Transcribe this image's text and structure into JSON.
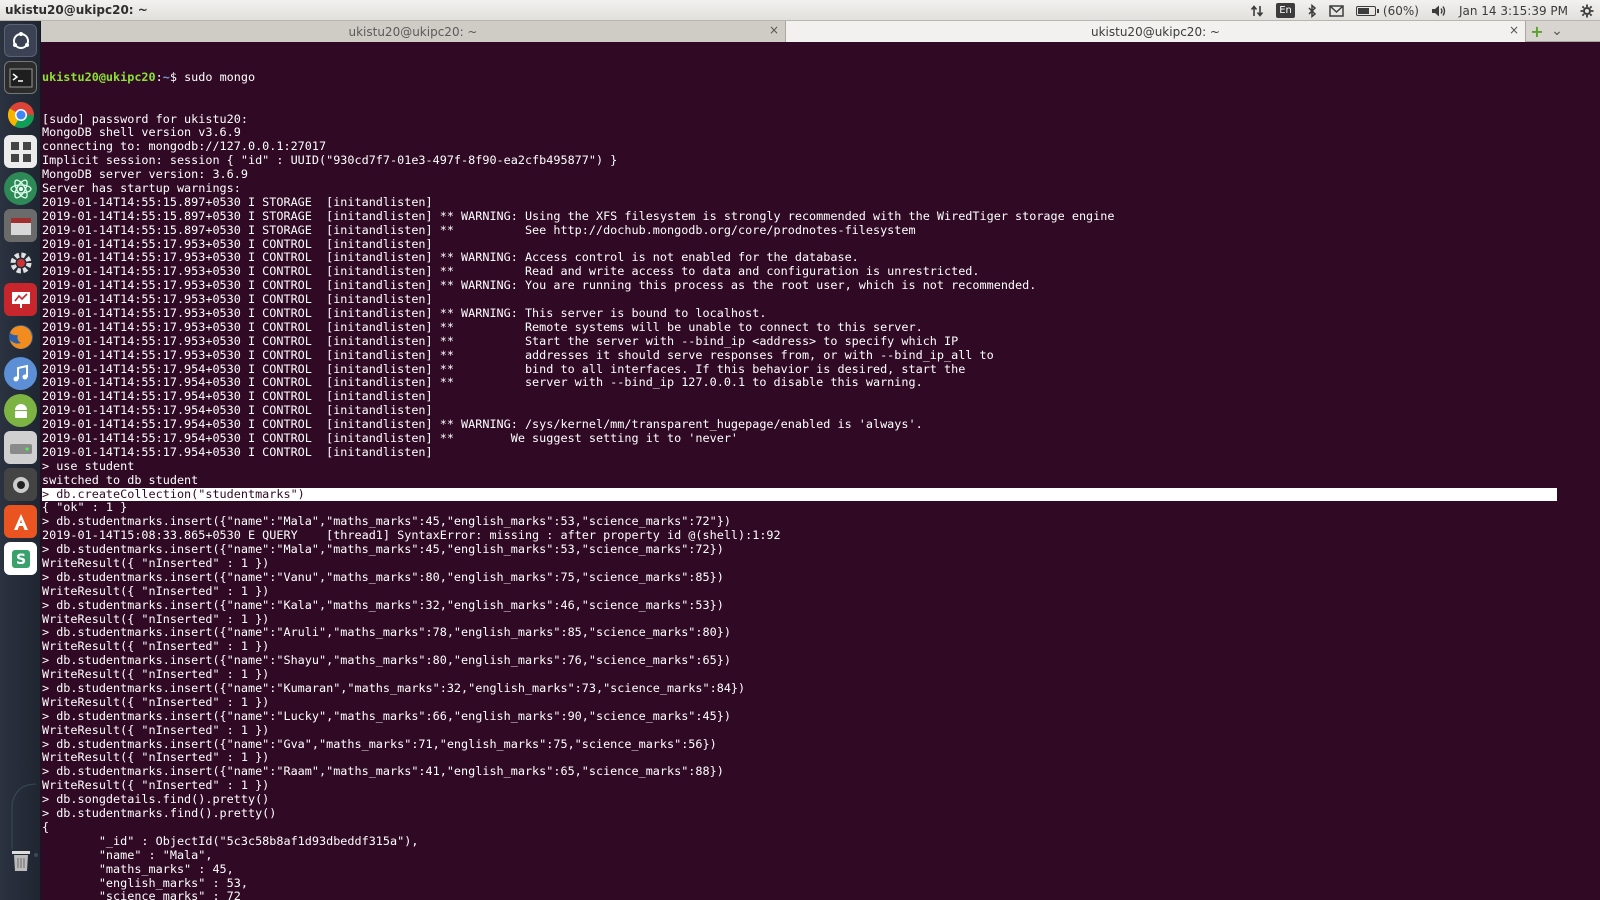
{
  "panel": {
    "title": "ukistu20@ukipc20: ~",
    "lang": "En",
    "battery": "(60%)",
    "battery_level": 0.6,
    "datetime": "Jan 14  3:15:39 PM"
  },
  "tabs": [
    {
      "title": "ukistu20@ukipc20: ~",
      "close": "×"
    },
    {
      "title": "ukistu20@ukipc20: ~",
      "close": "×"
    }
  ],
  "tab_new": "+",
  "tab_menu": "⌄",
  "launcher_icons": [
    "dash-home-icon",
    "terminal-icon",
    "chrome-icon",
    "apps-grid-icon",
    "atom-icon",
    "files-icon",
    "system-settings-icon",
    "presentation-icon",
    "firefox-icon",
    "music-icon",
    "android-icon",
    "drive-icon",
    "camera-icon",
    "software-center-icon",
    "slack-icon",
    "trash-icon"
  ],
  "terminal": {
    "prompt_user": "ukistu20@ukipc20",
    "prompt_sep": ":",
    "prompt_path": "~",
    "prompt_cmd": "$ sudo mongo",
    "lines": [
      "[sudo] password for ukistu20:",
      "MongoDB shell version v3.6.9",
      "connecting to: mongodb://127.0.0.1:27017",
      "Implicit session: session { \"id\" : UUID(\"930cd7f7-01e3-497f-8f90-ea2cfb495877\") }",
      "MongoDB server version: 3.6.9",
      "Server has startup warnings:",
      "2019-01-14T14:55:15.897+0530 I STORAGE  [initandlisten]",
      "2019-01-14T14:55:15.897+0530 I STORAGE  [initandlisten] ** WARNING: Using the XFS filesystem is strongly recommended with the WiredTiger storage engine",
      "2019-01-14T14:55:15.897+0530 I STORAGE  [initandlisten] **          See http://dochub.mongodb.org/core/prodnotes-filesystem",
      "2019-01-14T14:55:17.953+0530 I CONTROL  [initandlisten]",
      "2019-01-14T14:55:17.953+0530 I CONTROL  [initandlisten] ** WARNING: Access control is not enabled for the database.",
      "2019-01-14T14:55:17.953+0530 I CONTROL  [initandlisten] **          Read and write access to data and configuration is unrestricted.",
      "2019-01-14T14:55:17.953+0530 I CONTROL  [initandlisten] ** WARNING: You are running this process as the root user, which is not recommended.",
      "2019-01-14T14:55:17.953+0530 I CONTROL  [initandlisten]",
      "2019-01-14T14:55:17.953+0530 I CONTROL  [initandlisten] ** WARNING: This server is bound to localhost.",
      "2019-01-14T14:55:17.953+0530 I CONTROL  [initandlisten] **          Remote systems will be unable to connect to this server.",
      "2019-01-14T14:55:17.953+0530 I CONTROL  [initandlisten] **          Start the server with --bind_ip <address> to specify which IP",
      "2019-01-14T14:55:17.953+0530 I CONTROL  [initandlisten] **          addresses it should serve responses from, or with --bind_ip_all to",
      "2019-01-14T14:55:17.954+0530 I CONTROL  [initandlisten] **          bind to all interfaces. If this behavior is desired, start the",
      "2019-01-14T14:55:17.954+0530 I CONTROL  [initandlisten] **          server with --bind_ip 127.0.0.1 to disable this warning.",
      "2019-01-14T14:55:17.954+0530 I CONTROL  [initandlisten]",
      "2019-01-14T14:55:17.954+0530 I CONTROL  [initandlisten]",
      "2019-01-14T14:55:17.954+0530 I CONTROL  [initandlisten] ** WARNING: /sys/kernel/mm/transparent_hugepage/enabled is 'always'.",
      "2019-01-14T14:55:17.954+0530 I CONTROL  [initandlisten] **        We suggest setting it to 'never'",
      "2019-01-14T14:55:17.954+0530 I CONTROL  [initandlisten]",
      "> use student",
      "switched to db student",
      "> db.createCollection(\"studentmarks\")",
      "{ \"ok\" : 1 }",
      "> db.studentmarks.insert({\"name\":\"Mala\",\"maths_marks\":45,\"english_marks\":53,\"science_marks\":72\"})",
      "2019-01-14T15:08:33.865+0530 E QUERY    [thread1] SyntaxError: missing : after property id @(shell):1:92",
      "> db.studentmarks.insert({\"name\":\"Mala\",\"maths_marks\":45,\"english_marks\":53,\"science_marks\":72})",
      "WriteResult({ \"nInserted\" : 1 })",
      "> db.studentmarks.insert({\"name\":\"Vanu\",\"maths_marks\":80,\"english_marks\":75,\"science_marks\":85})",
      "WriteResult({ \"nInserted\" : 1 })",
      "> db.studentmarks.insert({\"name\":\"Kala\",\"maths_marks\":32,\"english_marks\":46,\"science_marks\":53})",
      "WriteResult({ \"nInserted\" : 1 })",
      "> db.studentmarks.insert({\"name\":\"Aruli\",\"maths_marks\":78,\"english_marks\":85,\"science_marks\":80})",
      "WriteResult({ \"nInserted\" : 1 })",
      "> db.studentmarks.insert({\"name\":\"Shayu\",\"maths_marks\":80,\"english_marks\":76,\"science_marks\":65})",
      "WriteResult({ \"nInserted\" : 1 })",
      "> db.studentmarks.insert({\"name\":\"Kumaran\",\"maths_marks\":32,\"english_marks\":73,\"science_marks\":84})",
      "WriteResult({ \"nInserted\" : 1 })",
      "> db.studentmarks.insert({\"name\":\"Lucky\",\"maths_marks\":66,\"english_marks\":90,\"science_marks\":45})",
      "WriteResult({ \"nInserted\" : 1 })",
      "> db.studentmarks.insert({\"name\":\"Gva\",\"maths_marks\":71,\"english_marks\":75,\"science_marks\":56})",
      "WriteResult({ \"nInserted\" : 1 })",
      "> db.studentmarks.insert({\"name\":\"Raam\",\"maths_marks\":41,\"english_marks\":65,\"science_marks\":88})",
      "WriteResult({ \"nInserted\" : 1 })",
      "> db.songdetails.find().pretty()",
      "> db.studentmarks.find().pretty()",
      "{",
      "        \"_id\" : ObjectId(\"5c3c58b8af1d93dbeddf315a\"),",
      "        \"name\" : \"Mala\",",
      "        \"maths_marks\" : 45,",
      "        \"english_marks\" : 53,",
      "        \"science_marks\" : 72",
      "}",
      "{"
    ],
    "selected_line_index": 27
  }
}
